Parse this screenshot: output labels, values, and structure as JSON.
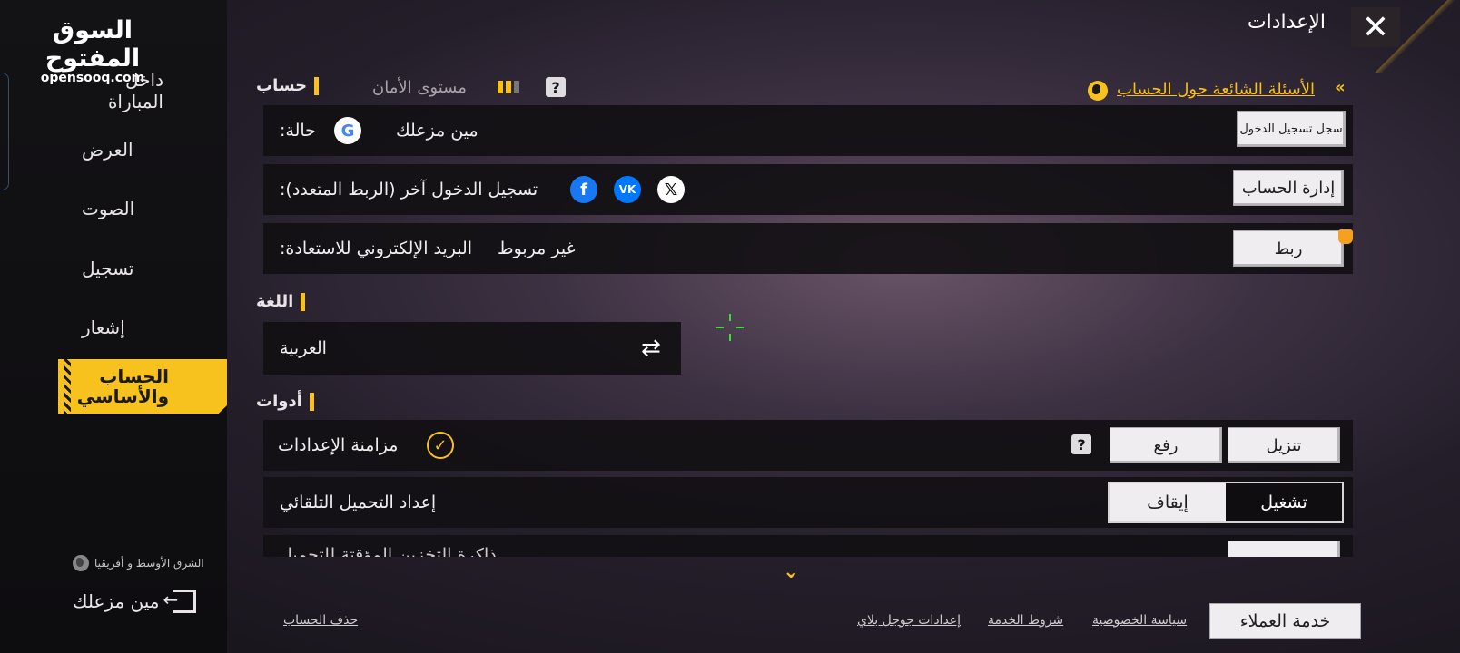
{
  "watermark": {
    "arabic": "السوق المفتوح",
    "latin": "opensooq.com"
  },
  "header": {
    "title": "الإعدادات",
    "close_symbol": "✕"
  },
  "sidebar": {
    "items": [
      {
        "label": "داخل المباراة"
      },
      {
        "label": "العرض"
      },
      {
        "label": "الصوت"
      },
      {
        "label": "تسجيل"
      },
      {
        "label": "إشعار"
      },
      {
        "label": "الحساب والأساسي",
        "active": true
      }
    ],
    "region": "الشرق الأوسط و أفريقيا",
    "username": "مين مزعلك"
  },
  "account": {
    "section_title": "حساب",
    "security_label": "مستوى الأمان",
    "security_level": 2,
    "security_max": 3,
    "help": "?",
    "faq_link": "الأسئلة الشائعة حول الحساب",
    "faq_chevrons": "«",
    "status_label": "حالة:",
    "status_name": "مين مزعلك",
    "login_log_button": "سجل تسجيل الدخول",
    "other_login_label": "تسجيل الدخول آخر (الربط المتعدد):",
    "manage_account_button": "إدارة الحساب",
    "email_label": "البريد الإلكتروني للاستعادة:",
    "email_status": "غير مربوط",
    "link_button": "ربط",
    "icons": {
      "google": "G",
      "facebook": "f",
      "vk": "VK",
      "x": "𝕏"
    }
  },
  "language": {
    "section_title": "اللغة",
    "current": "العربية",
    "swap_symbol": "⇄"
  },
  "tools": {
    "section_title": "أدوات",
    "sync_label": "مزامنة الإعدادات",
    "upload_button": "رفع",
    "download_button": "تنزيل",
    "auto_download_label": "إعداد التحميل التلقائي",
    "toggle_on": "تشغيل",
    "toggle_off": "إيقاف",
    "toggle_state": "on",
    "partial_row": "ذاكرة التخزين المؤقتة للتحميل"
  },
  "footer": {
    "delete_account": "حذف الحساب",
    "google_play_settings": "إعدادات جوجل بلاي",
    "terms": "شروط الخدمة",
    "privacy": "سياسة الخصوصية",
    "customer_service": "خدمة العملاء"
  },
  "colors": {
    "accent": "#f7c11e",
    "panel": "#121014",
    "button": "#efedef"
  }
}
